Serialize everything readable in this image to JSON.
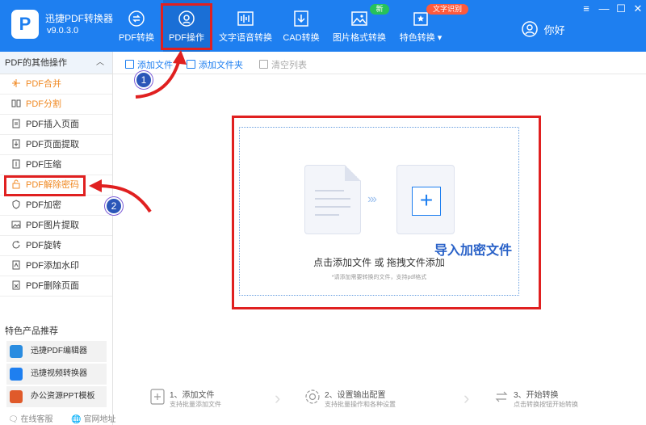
{
  "app": {
    "logo_letter": "P",
    "name": "迅捷PDF转换器",
    "version": "v9.0.3.0"
  },
  "nav": [
    {
      "label": "PDF转换"
    },
    {
      "label": "PDF操作"
    },
    {
      "label": "文字语音转换"
    },
    {
      "label": "CAD转换"
    },
    {
      "label": "图片格式转换"
    },
    {
      "label": "特色转换"
    }
  ],
  "badges": {
    "new": "新",
    "ocr": "文字识别"
  },
  "user": {
    "greeting": "你好"
  },
  "sidebar": {
    "header": "PDF的其他操作",
    "items": [
      {
        "label": "PDF合并"
      },
      {
        "label": "PDF分割"
      },
      {
        "label": "PDF插入页面"
      },
      {
        "label": "PDF页面提取"
      },
      {
        "label": "PDF压缩"
      },
      {
        "label": "PDF解除密码"
      },
      {
        "label": "PDF加密"
      },
      {
        "label": "PDF图片提取"
      },
      {
        "label": "PDF旋转"
      },
      {
        "label": "PDF添加水印"
      },
      {
        "label": "PDF删除页面"
      }
    ],
    "recommend_title": "特色产品推荐",
    "recommend": [
      {
        "label": "迅捷PDF编辑器"
      },
      {
        "label": "迅捷视频转换器"
      },
      {
        "label": "办公资源PPT模板"
      }
    ],
    "footer": {
      "online_service": "在线客服",
      "website": "官网地址"
    }
  },
  "toolbar": {
    "add_file": "添加文件",
    "add_folder": "添加文件夹",
    "clear_list": "清空列表"
  },
  "dropzone": {
    "main": "点击添加文件 或 拖拽文件添加",
    "sub": "*请添加需要转换的文件，支持pdf格式"
  },
  "annotation": {
    "overlay_text": "导入加密文件",
    "step1_number": "1",
    "step2_number": "2"
  },
  "steps": [
    {
      "title": "1、添加文件",
      "desc": "支持批量添加文件"
    },
    {
      "title": "2、设置输出配置",
      "desc": "支持批量操作和各种设置"
    },
    {
      "title": "3、开始转换",
      "desc": "点击转换按钮开始转换"
    }
  ],
  "colors": {
    "header_blue": "#1e7ff0",
    "highlight_red": "#e02020",
    "active_orange": "#f08a24",
    "badge_green": "#27c25a",
    "annotation_blue": "#2a62c8"
  }
}
